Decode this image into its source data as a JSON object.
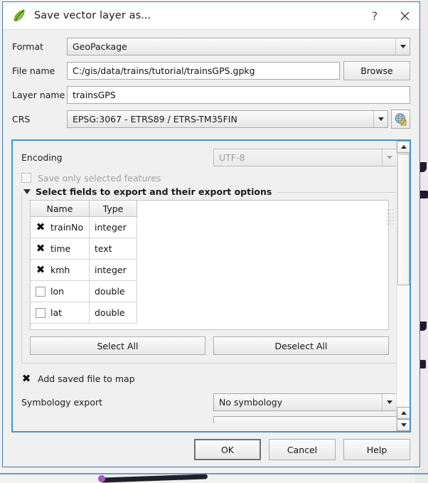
{
  "window": {
    "title": "Save vector layer as...",
    "app_icon": "qgis-leaf-icon",
    "help_glyph": "?",
    "close_glyph": "✕"
  },
  "form": {
    "format": {
      "label": "Format",
      "value": "GeoPackage"
    },
    "file_name": {
      "label": "File name",
      "value": "C:/gis/data/trains/tutorial/trainsGPS.gpkg",
      "browse_label": "Browse"
    },
    "layer_name": {
      "label": "Layer name",
      "value": "trainsGPS"
    },
    "crs": {
      "label": "CRS",
      "value": "EPSG:3067 - ETRS89 / ETRS-TM35FIN",
      "picker_icon": "globe-crs-icon"
    }
  },
  "options": {
    "encoding": {
      "label": "Encoding",
      "value": "UTF-8",
      "disabled": true
    },
    "save_only_selected": {
      "label": "Save only selected features",
      "checked": false,
      "disabled": true
    },
    "fields_group": {
      "title": "Select fields to export and their export options",
      "expanded": true
    },
    "table": {
      "columns": [
        "Name",
        "Type"
      ],
      "rows": [
        {
          "checked": true,
          "name": "trainNo",
          "type": "integer"
        },
        {
          "checked": true,
          "name": "time",
          "type": "text"
        },
        {
          "checked": true,
          "name": "kmh",
          "type": "integer"
        },
        {
          "checked": false,
          "name": "lon",
          "type": "double"
        },
        {
          "checked": false,
          "name": "lat",
          "type": "double"
        }
      ]
    },
    "select_all_label": "Select All",
    "deselect_all_label": "Deselect All",
    "add_saved_file": {
      "label": "Add saved file to map",
      "checked": true
    },
    "symbology_export": {
      "label": "Symbology export",
      "value": "No symbology"
    }
  },
  "buttons": {
    "ok": "OK",
    "cancel": "Cancel",
    "help": "Help"
  },
  "colors": {
    "focus_border": "#3a96dd",
    "title_bg": "#ffffff",
    "dialog_bg": "#f0f0f0"
  },
  "check_glyph": "✖"
}
